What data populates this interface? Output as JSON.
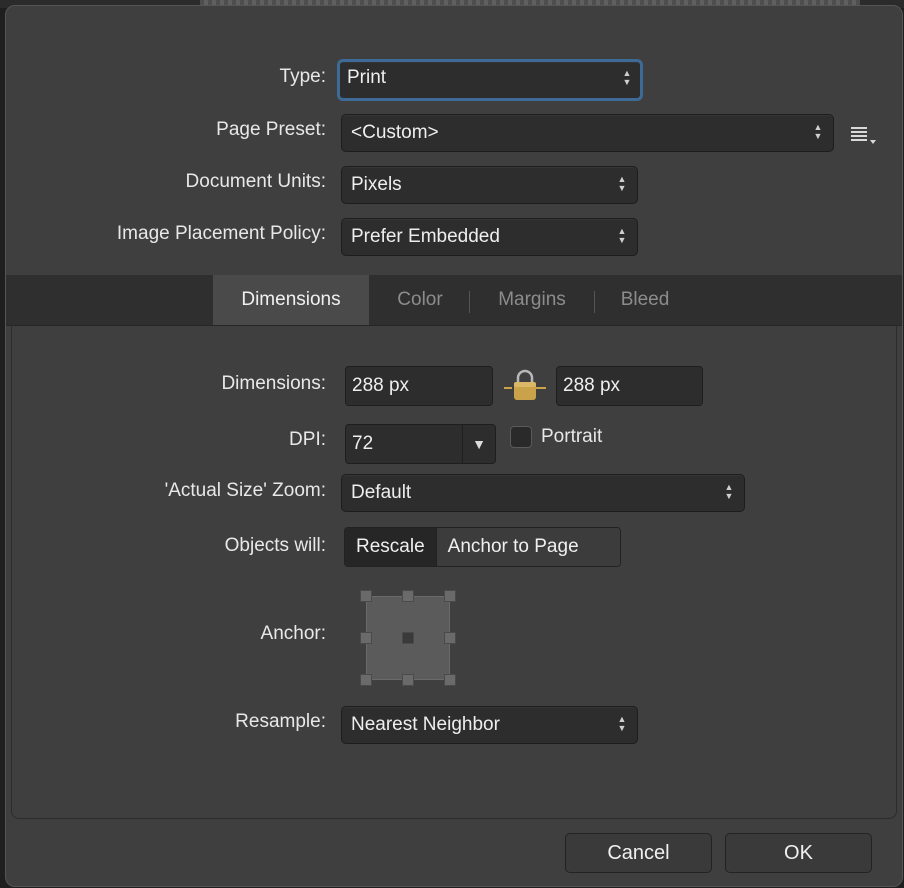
{
  "form": {
    "type_label": "Type:",
    "type_value": "Print",
    "page_preset_label": "Page Preset:",
    "page_preset_value": "<Custom>",
    "document_units_label": "Document Units:",
    "document_units_value": "Pixels",
    "image_placement_label": "Image Placement Policy:",
    "image_placement_value": "Prefer Embedded"
  },
  "tabs": [
    {
      "label": "Dimensions",
      "active": true
    },
    {
      "label": "Color",
      "active": false
    },
    {
      "label": "Margins",
      "active": false
    },
    {
      "label": "Bleed",
      "active": false
    }
  ],
  "dimensions": {
    "label": "Dimensions:",
    "width": "288 px",
    "height": "288 px",
    "dpi_label": "DPI:",
    "dpi_value": "72",
    "portrait_label": "Portrait",
    "zoom_label": "'Actual Size' Zoom:",
    "zoom_value": "Default",
    "objects_label": "Objects will:",
    "objects_options": [
      "Rescale",
      "Anchor to Page"
    ],
    "anchor_label": "Anchor:",
    "resample_label": "Resample:",
    "resample_value": "Nearest Neighbor"
  },
  "footer": {
    "cancel": "Cancel",
    "ok": "OK"
  },
  "icons": {
    "preset_menu": "list-menu-icon",
    "lock": "lock-icon",
    "popup_arrows": "up-down-arrows-icon",
    "dpi_dropdown": "triangle-down-icon"
  },
  "colors": {
    "focus_ring": "#3d6a96",
    "lock_gold": "#c9a24a"
  }
}
